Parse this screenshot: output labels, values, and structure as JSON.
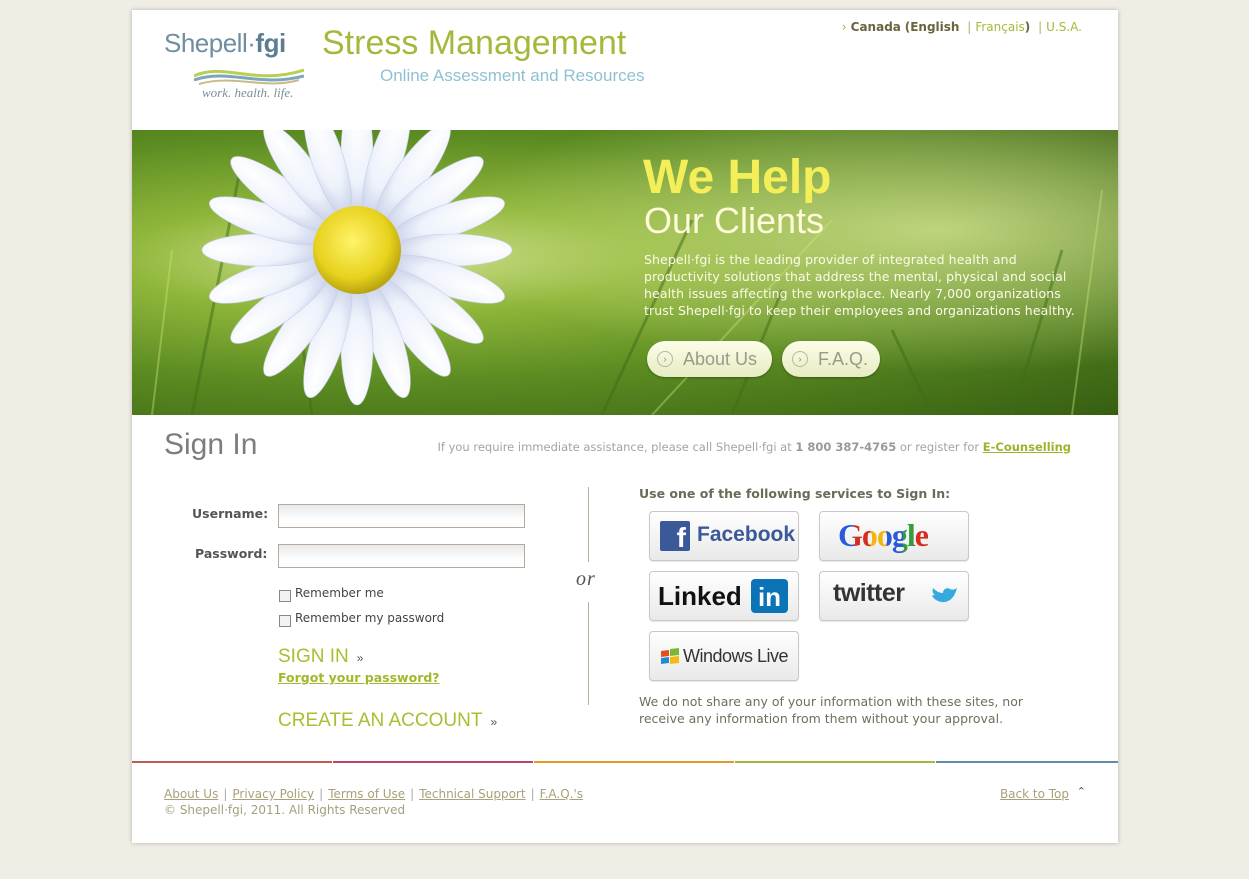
{
  "header": {
    "logo_main": "Shepell",
    "logo_dot": "·",
    "logo_bold": "fgi",
    "logo_tagline": "work. health. life.",
    "site_title": "Stress Management",
    "site_subtitle": "Online Assessment and Resources"
  },
  "lang": {
    "country": "Canada",
    "open_paren": "(",
    "english": "English",
    "separator": "|",
    "french": "Français",
    "close_paren": ")",
    "usa": "U.S.A."
  },
  "hero": {
    "title_line1": "We Help",
    "title_line2": "Our Clients",
    "body": "Shepell·fgi is the leading provider of integrated health and productivity solutions that address the mental, physical and social health issues affecting the workplace. Nearly 7,000 organizations trust Shepell·fgi to keep their employees and organizations healthy.",
    "about_label": "About Us",
    "faq_label": "F.A.Q."
  },
  "signin": {
    "heading": "Sign In",
    "assist_text": "If you require immediate assistance, please call Shepell·fgi at",
    "assist_phone": "1 800 387-4765",
    "assist_or": "or register for",
    "assist_link": "E-Counselling",
    "username_label": "Username:",
    "password_label": "Password:",
    "username_value": "",
    "password_value": "",
    "remember_me": "Remember me",
    "remember_password": "Remember my password",
    "sign_in_button": "SIGN IN",
    "forgot_link": "Forgot your password?",
    "create_account": "CREATE AN ACCOUNT",
    "or_text": "or"
  },
  "services": {
    "heading": "Use one of the following services to Sign In:",
    "facebook": "Facebook",
    "google": "Google",
    "linkedin_text": "Linked",
    "linkedin_box": "in",
    "twitter": "twitter",
    "windows_live": "Windows Live",
    "privacy_note": "We do not share any of your information with these sites, nor receive any information from them without your approval."
  },
  "footer": {
    "links": [
      "About Us",
      "Privacy Policy",
      "Terms of Use",
      "Technical Support",
      "F.A.Q.'s"
    ],
    "copyright": "© Shepell·fgi, 2011. All Rights Reserved",
    "back_to_top": "Back to Top"
  },
  "colors": {
    "accent_green": "#a6b83b",
    "hero_title": "#f4ee58",
    "facebook_blue": "#3b5998",
    "linkedin_blue": "#0a74b6",
    "footer_rule": [
      "#c05b4e",
      "#c0436b",
      "#e39a2c",
      "#a3b83c",
      "#5e8fa7"
    ]
  },
  "icons": {
    "lang_arrow": "chevron-right-icon",
    "pill_arrow": "circle-chevron-icon",
    "sign_in_arrow": "double-chevron-icon",
    "back_to_top": "caret-up-icon"
  }
}
